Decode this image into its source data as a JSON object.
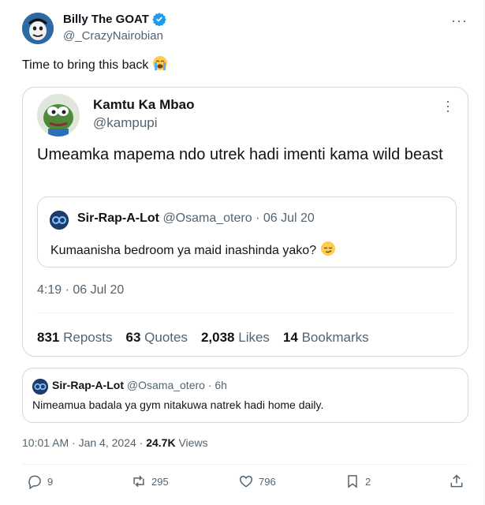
{
  "author": {
    "name": "Billy The GOAT",
    "handle": "@_CrazyNairobian",
    "verified": true,
    "avatar_icon": "meme-face-avatar-icon"
  },
  "tweet": {
    "text": "Time to bring this back",
    "emoji": "crying-face-icon"
  },
  "quoted": {
    "name": "Kamtu Ka Mbao",
    "handle": "@kampupi",
    "avatar_icon": "pepe-frog-avatar-icon",
    "text": "Umeamka mapema ndo utrek hadi imenti kama wild beast",
    "time": "4:19 · 06 Jul 20",
    "inner": {
      "name": "Sir-Rap-A-Lot",
      "handle": "@Osama_otero",
      "date": "· 06 Jul 20",
      "text": "Kumaanisha bedroom ya maid inashinda yako?",
      "emoji": "smirk-face-icon"
    },
    "stats": [
      {
        "value": "831",
        "label": "Reposts"
      },
      {
        "value": "63",
        "label": "Quotes"
      },
      {
        "value": "2,038",
        "label": "Likes"
      },
      {
        "value": "14",
        "label": "Bookmarks"
      }
    ]
  },
  "quoted2": {
    "name": "Sir-Rap-A-Lot",
    "handle": "@Osama_otero",
    "age": "· 6h",
    "text": "Nimeamua badala ya gym nitakuwa natrek hadi home daily."
  },
  "meta": {
    "time": "10:01 AM · Jan 4, 2024 ·",
    "views_count": "24.7K",
    "views_label": "Views"
  },
  "actions": {
    "replies": "9",
    "reposts": "295",
    "likes": "796",
    "bookmarks": "2"
  },
  "colors": {
    "verified": "#1d9bf0",
    "secondary_text": "#536471",
    "border": "#cfd9de"
  }
}
